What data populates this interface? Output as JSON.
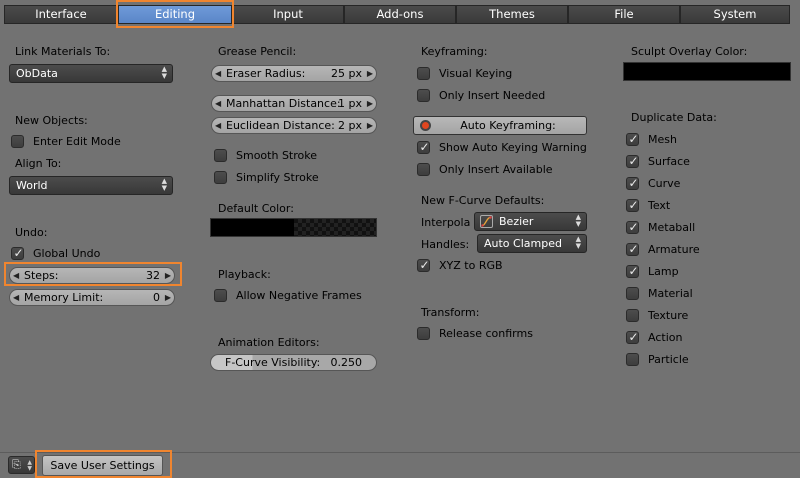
{
  "tabs": [
    "Interface",
    "Editing",
    "Input",
    "Add-ons",
    "Themes",
    "File",
    "System"
  ],
  "col1": {
    "link_materials_label": "Link Materials To:",
    "link_materials_value": "ObData",
    "new_objects_label": "New Objects:",
    "enter_edit_mode": "Enter Edit Mode",
    "align_to_label": "Align To:",
    "align_to_value": "World",
    "undo_label": "Undo:",
    "global_undo": "Global Undo",
    "steps_label": "Steps:",
    "steps_value": "32",
    "memory_limit_label": "Memory Limit:",
    "memory_limit_value": "0"
  },
  "col2": {
    "grease_pencil_label": "Grease Pencil:",
    "eraser_radius_label": "Eraser Radius:",
    "eraser_radius_value": "25 px",
    "manhattan_label": "Manhattan Distance:",
    "manhattan_value": "1 px",
    "euclidean_label": "Euclidean Distance:",
    "euclidean_value": "2 px",
    "smooth_stroke": "Smooth Stroke",
    "simplify_stroke": "Simplify Stroke",
    "default_color_label": "Default Color:",
    "playback_label": "Playback:",
    "allow_negative_frames": "Allow Negative Frames",
    "animation_editors_label": "Animation Editors:",
    "fcurve_visibility_label": "F-Curve Visibility:",
    "fcurve_visibility_value": "0.250"
  },
  "col3": {
    "keyframing_label": "Keyframing:",
    "visual_keying": "Visual Keying",
    "only_insert_needed": "Only Insert Needed",
    "auto_keyframing": "Auto Keyframing:",
    "show_auto_keying_warning": "Show Auto Keying Warning",
    "only_insert_available": "Only Insert Available",
    "new_fcurve_defaults_label": "New F-Curve Defaults:",
    "interpola_label": "Interpola",
    "interpola_value": "Bezier",
    "handles_label": "Handles:",
    "handles_value": "Auto Clamped",
    "xyz_to_rgb": "XYZ to RGB",
    "transform_label": "Transform:",
    "release_confirms": "Release confirms"
  },
  "col4": {
    "sculpt_overlay_label": "Sculpt Overlay Color:",
    "duplicate_data_label": "Duplicate Data:",
    "items": [
      {
        "label": "Mesh",
        "checked": true
      },
      {
        "label": "Surface",
        "checked": true
      },
      {
        "label": "Curve",
        "checked": true
      },
      {
        "label": "Text",
        "checked": true
      },
      {
        "label": "Metaball",
        "checked": true
      },
      {
        "label": "Armature",
        "checked": true
      },
      {
        "label": "Lamp",
        "checked": true
      },
      {
        "label": "Material",
        "checked": false
      },
      {
        "label": "Texture",
        "checked": false
      },
      {
        "label": "Action",
        "checked": true
      },
      {
        "label": "Particle",
        "checked": false
      }
    ]
  },
  "footer": {
    "save_label": "Save User Settings"
  },
  "colors": {
    "accent_highlight": "#f0852f",
    "active_tab": "#5a86c8",
    "background": "#727272"
  }
}
